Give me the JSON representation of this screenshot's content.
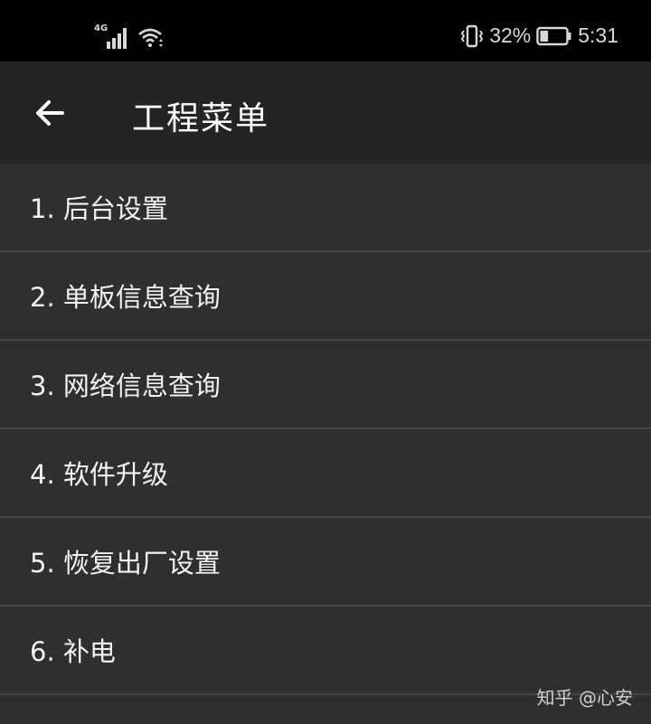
{
  "status_bar": {
    "network_type": "4G",
    "battery_percent": "32%",
    "time": "5:31",
    "battery_level": 0.32,
    "icons": [
      "signal-icon",
      "wifi-icon",
      "vibrate-icon",
      "battery-icon"
    ]
  },
  "app_bar": {
    "title": "工程菜单",
    "back_icon": "arrow-left-icon"
  },
  "menu": {
    "items": [
      {
        "label": "1. 后台设置"
      },
      {
        "label": "2. 单板信息查询"
      },
      {
        "label": "3. 网络信息查询"
      },
      {
        "label": "4. 软件升级"
      },
      {
        "label": "5. 恢复出厂设置"
      },
      {
        "label": "6. 补电"
      }
    ]
  },
  "watermark": {
    "text": "知乎 @心安"
  },
  "colors": {
    "status_bar_bg": "#000000",
    "app_bar_bg": "#242424",
    "list_bg": "#2f2f2f",
    "divider": "#474747",
    "text": "#ffffff"
  }
}
